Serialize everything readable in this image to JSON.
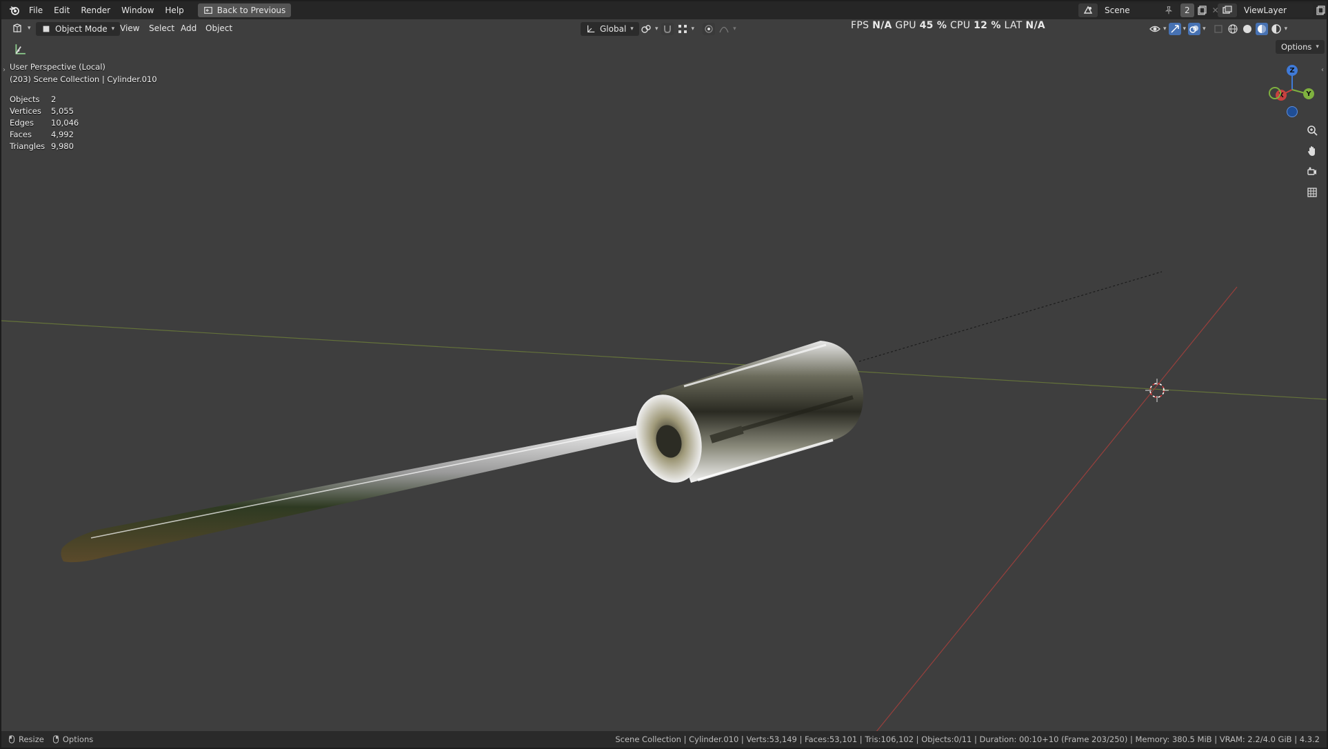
{
  "topbar": {
    "menus": [
      "File",
      "Edit",
      "Render",
      "Window",
      "Help"
    ],
    "back_button": "Back to Previous",
    "scene_name": "Scene",
    "scene_users": "2",
    "view_layer": "ViewLayer"
  },
  "header": {
    "mode": "Object Mode",
    "menus": [
      "View",
      "Select",
      "Add",
      "Object"
    ],
    "orientation": "Global",
    "options": "Options"
  },
  "perf": {
    "fps_label": "FPS",
    "fps_value": "N/A",
    "gpu_label": "GPU",
    "gpu_value": "45 %",
    "cpu_label": "CPU",
    "cpu_value": "12 %",
    "lat_label": "LAT",
    "lat_value": "N/A"
  },
  "viewport": {
    "view_name": "User Perspective (Local)",
    "collection_info": "(203) Scene Collection | Cylinder.010",
    "stats": [
      {
        "label": "Objects",
        "value": "2"
      },
      {
        "label": "Vertices",
        "value": "5,055"
      },
      {
        "label": "Edges",
        "value": "10,046"
      },
      {
        "label": "Faces",
        "value": "4,992"
      },
      {
        "label": "Triangles",
        "value": "9,980"
      }
    ],
    "gizmo": {
      "z": "Z",
      "x": "X",
      "y": "Y"
    }
  },
  "statusbar": {
    "resize": "Resize",
    "options": "Options",
    "info": "Scene Collection | Cylinder.010 | Verts:53,149 | Faces:53,101 | Tris:106,102 | Objects:0/11 | Duration: 00:10+10 (Frame 203/250) | Memory: 380.5 MiB | VRAM: 2.2/4.0 GiB | 4.3.2"
  },
  "colors": {
    "axis_x": "#c8413f",
    "axis_y": "#7fb13f",
    "axis_z": "#3f7ad8",
    "accent": "#4772b3"
  }
}
